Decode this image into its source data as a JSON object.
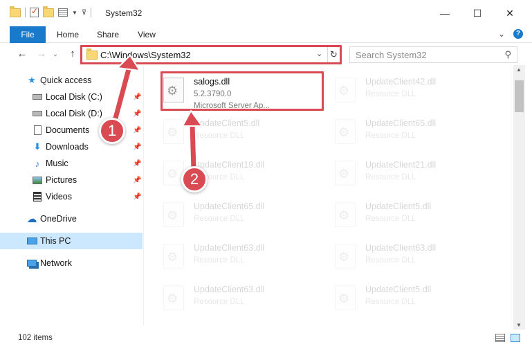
{
  "window": {
    "title": "System32",
    "controls": {
      "minimize": "—",
      "maximize": "☐",
      "close": "✕"
    }
  },
  "ribbon": {
    "tabs": [
      "File",
      "Home",
      "Share",
      "View"
    ],
    "collapse_glyph": "⌄",
    "help_glyph": "?"
  },
  "navigation": {
    "back": "←",
    "forward": "→",
    "up_dropdown": "⌄",
    "up": "↑",
    "address": "C:\\Windows\\System32",
    "address_dropdown": "⌄",
    "refresh": "↻",
    "search_placeholder": "Search System32",
    "search_glyph": "⚲"
  },
  "sidebar": {
    "items": [
      {
        "label": "Quick access",
        "icon": "star-icon",
        "pinned": false
      },
      {
        "label": "Local Disk (C:)",
        "icon": "drive-icon",
        "pinned": true
      },
      {
        "label": "Local Disk (D:)",
        "icon": "drive-icon",
        "pinned": true
      },
      {
        "label": "Documents",
        "icon": "documents-icon",
        "pinned": true
      },
      {
        "label": "Downloads",
        "icon": "download-icon",
        "pinned": true
      },
      {
        "label": "Music",
        "icon": "music-icon",
        "pinned": true
      },
      {
        "label": "Pictures",
        "icon": "pictures-icon",
        "pinned": true
      },
      {
        "label": "Videos",
        "icon": "videos-icon",
        "pinned": true
      },
      {
        "label": "OneDrive",
        "icon": "cloud-icon",
        "pinned": false
      },
      {
        "label": "This PC",
        "icon": "computer-icon",
        "pinned": false,
        "selected": true
      },
      {
        "label": "Network",
        "icon": "network-icon",
        "pinned": false
      }
    ]
  },
  "files": {
    "left_column": [
      {
        "name": "salogs.dll",
        "line1": "5.2.3790.0",
        "line2": "Microsoft Server Ap...",
        "highlighted": true
      },
      {
        "name": "UpdateClient5.dll",
        "line1": "Resource DLL"
      },
      {
        "name": "UpdateClient19.dll",
        "line1": "Resource DLL"
      },
      {
        "name": "UpdateClient65.dll",
        "line1": "Resource DLL"
      },
      {
        "name": "UpdateClient63.dll",
        "line1": "Resource DLL"
      },
      {
        "name": "UpdateClient63.dll",
        "line1": "Resource DLL"
      }
    ],
    "right_column": [
      {
        "name": "UpdateClient42.dll",
        "line1": "Resource DLL"
      },
      {
        "name": "UpdateClient65.dll",
        "line1": "Resource DLL"
      },
      {
        "name": "UpdateClient21.dll",
        "line1": "Resource DLL"
      },
      {
        "name": "UpdateClient5.dll",
        "line1": "Resource DLL"
      },
      {
        "name": "UpdateClient63.dll",
        "line1": "Resource DLL"
      },
      {
        "name": "UpdateClient5.dll",
        "line1": "Resource DLL"
      }
    ]
  },
  "status": {
    "item_count": "102 items"
  },
  "annotations": {
    "marker1": "1",
    "marker2": "2",
    "color": "#d94a52"
  },
  "colors": {
    "accent": "#1979ca",
    "selection": "#cce8ff",
    "highlight": "#d94a52"
  }
}
